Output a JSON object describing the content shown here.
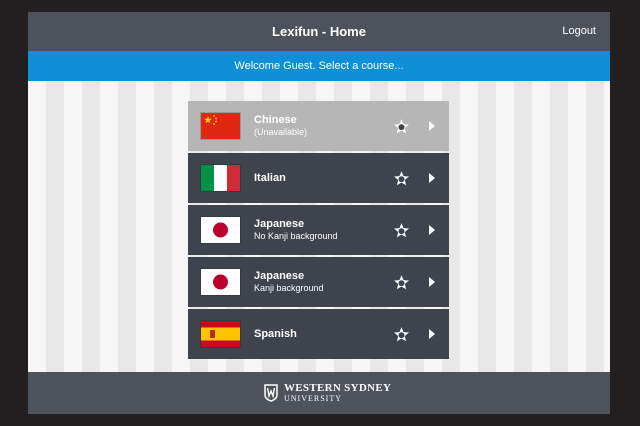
{
  "header": {
    "title": "Lexifun - Home",
    "logout_label": "Logout"
  },
  "banner": {
    "text": "Welcome Guest. Select a course..."
  },
  "courses": [
    {
      "name": "Chinese",
      "subtitle": "(Unavailable)",
      "flag_icon": "china-flag-icon",
      "available": false
    },
    {
      "name": "Italian",
      "subtitle": "",
      "flag_icon": "italy-flag-icon",
      "available": true
    },
    {
      "name": "Japanese",
      "subtitle": "No Kanji background",
      "flag_icon": "japan-flag-icon",
      "available": true
    },
    {
      "name": "Japanese",
      "subtitle": "Kanji background",
      "flag_icon": "japan-flag-icon",
      "available": true
    },
    {
      "name": "Spanish",
      "subtitle": "",
      "flag_icon": "spain-flag-icon",
      "available": true
    }
  ],
  "footer": {
    "logo_line1": "WESTERN SYDNEY",
    "logo_line2": "UNIVERSITY"
  },
  "colors": {
    "frame": "#231f20",
    "header": "#4e525a",
    "banner": "#0f8fd8",
    "course_row": "#3f434c",
    "course_row_unavailable": "#b6b6b6"
  }
}
